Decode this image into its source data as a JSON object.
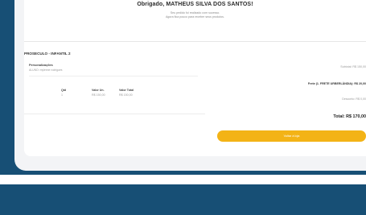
{
  "confirmation": {
    "thanks": "Obrigado, MATHEUS SILVA DOS SANTOS!",
    "line1": "Seu pedido foi realizado com sucesso.",
    "line2": "Agora fica pouco para receber seus produtos."
  },
  "product": {
    "name": "PROSECULO - INFANTIL 2",
    "personalization_label": "Personalizações",
    "personalization_value": "ALUNO: mylenne rodrigues",
    "columns": [
      {
        "header": "Qtd",
        "value": "1"
      },
      {
        "header": "Valor Un.",
        "value": "R$ 150,00"
      },
      {
        "header": "Valor Total",
        "value": "R$ 150,00"
      }
    ]
  },
  "summary": {
    "subtotal": "Subtotal: R$ 150,00",
    "frete": "Frete (1. FRETE URBERLÂNDIA): R$ 20,00",
    "desconto": "Desconto: R$ 0,00",
    "total": "Total: R$ 170,00"
  },
  "cta": {
    "label": "Voltar à loja"
  },
  "colors": {
    "brand_blue": "#174f75",
    "cta_yellow": "#f3b316"
  }
}
